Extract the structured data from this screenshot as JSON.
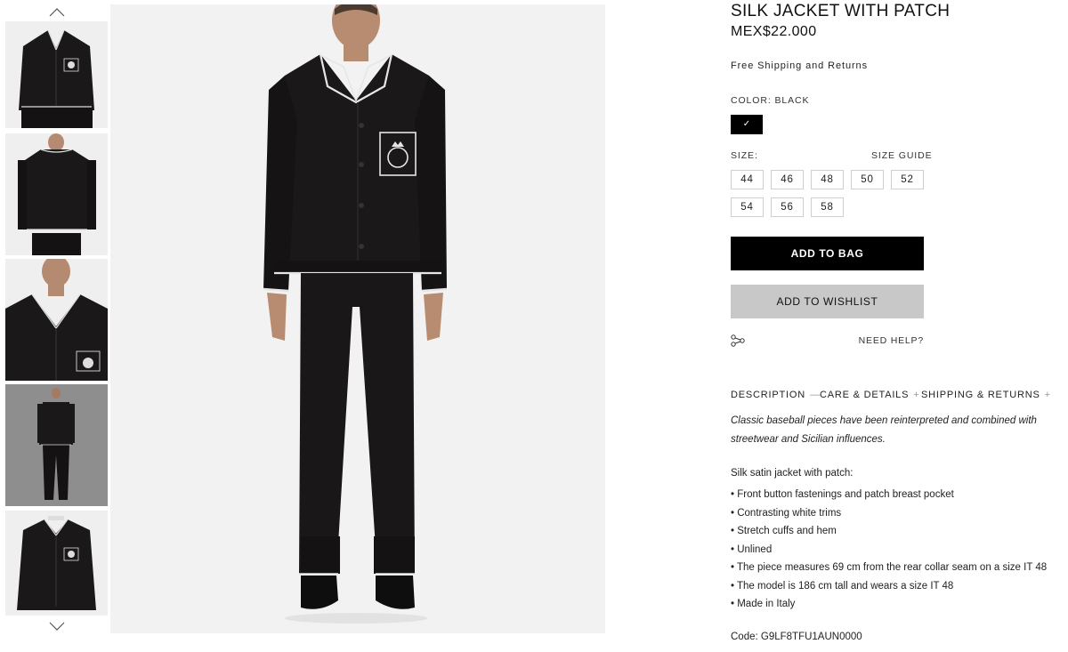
{
  "product": {
    "title": "SILK JACKET WITH PATCH",
    "price": "MEX$22.000",
    "shipping": "Free Shipping and Returns",
    "color_label": "COLOR: BLACK",
    "color_swatch_mark": "✓",
    "size_label": "SIZE:",
    "size_guide": "SIZE GUIDE",
    "sizes": [
      "44",
      "46",
      "48",
      "50",
      "52",
      "54",
      "56",
      "58"
    ],
    "add_to_bag": "ADD TO BAG",
    "add_to_wishlist": "ADD TO WISHLIST",
    "need_help": "NEED HELP?",
    "code": "Code: G9LF8TFU1AUN0000"
  },
  "tabs": [
    {
      "label": "DESCRIPTION",
      "sign": "—"
    },
    {
      "label": "CARE & DETAILS",
      "sign": "+"
    },
    {
      "label": "SHIPPING & RETURNS",
      "sign": "+"
    }
  ],
  "description": {
    "lead": "Classic baseball pieces have been reinterpreted and combined with streetwear and Sicilian influences.",
    "subtitle": "Silk satin jacket with patch:",
    "bullets": [
      "• Front button fastenings and patch breast pocket",
      "• Contrasting white trims",
      "• Stretch cuffs and hem",
      "• Unlined",
      "• The piece measures 69 cm from the rear collar seam on a size IT 48",
      "• The model is 186 cm tall and wears a size IT 48",
      "• Made in Italy"
    ]
  },
  "icons": {
    "thumb_up": "chevron-up-icon",
    "thumb_down": "chevron-down-icon",
    "share": "share-icon"
  },
  "colors": {
    "primary_button": "#000000",
    "secondary_button": "#c8c8c8",
    "garment": "#1b1819",
    "trim": "#e6e6e6",
    "image_bg": "#f2f2f2"
  }
}
